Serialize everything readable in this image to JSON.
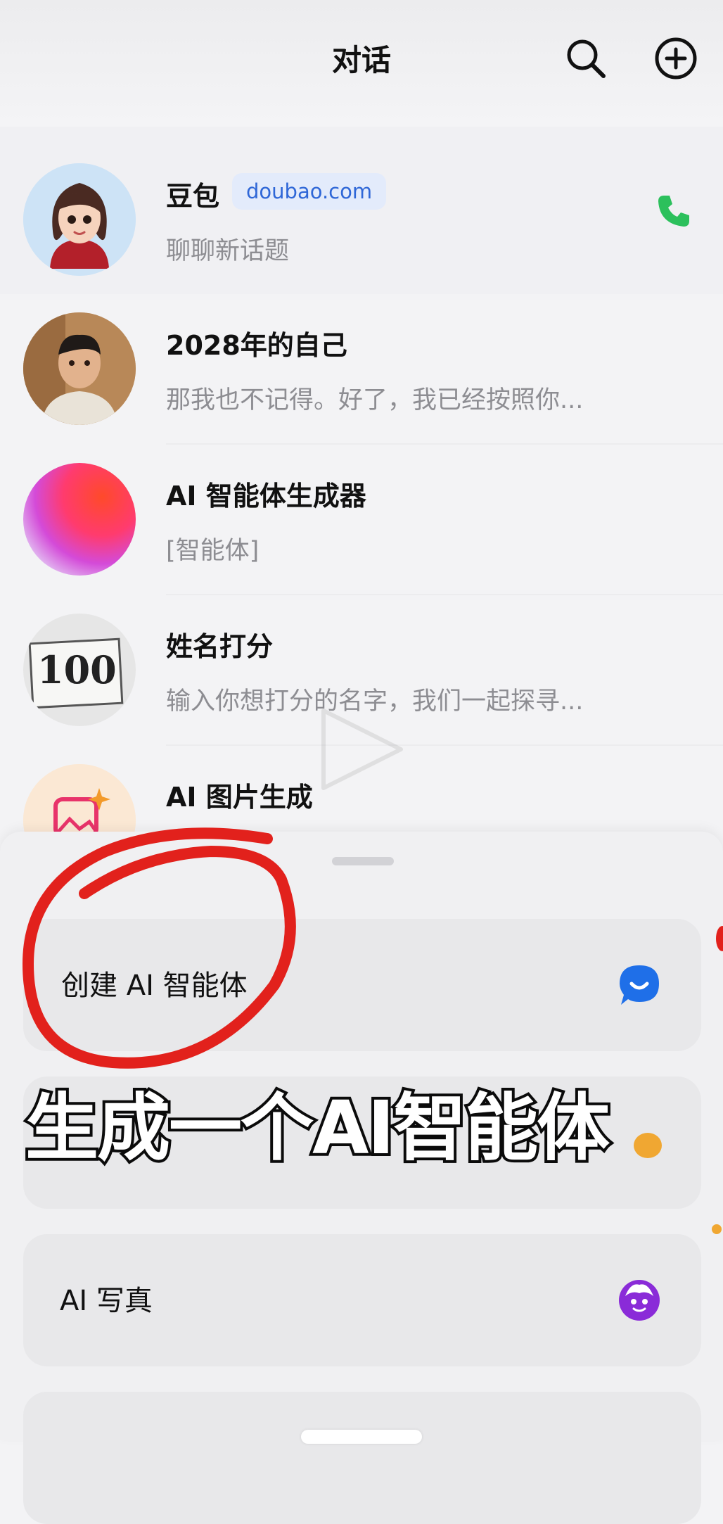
{
  "header": {
    "title": "对话",
    "search_icon": "search-icon",
    "add_icon": "plus-circle-icon"
  },
  "conversations": [
    {
      "name": "豆包",
      "badge": "doubao.com",
      "preview": "聊聊新话题",
      "action_icon": "phone-icon",
      "pinned": true
    },
    {
      "name": "2028年的自己",
      "preview": "那我也不记得。好了，我已经按照你..."
    },
    {
      "name": "AI 智能体生成器",
      "preview": "[智能体]"
    },
    {
      "name": "姓名打分",
      "preview": "输入你想打分的名字，我们一起探寻...",
      "avatar_text": "100"
    },
    {
      "name": "AI 图片生成",
      "preview": ""
    }
  ],
  "sheet": {
    "cards": [
      {
        "label": "创建 AI 智能体",
        "icon": "chat-bubble-icon"
      },
      {
        "label": "",
        "icon": "orange-icon"
      },
      {
        "label": "AI 写真",
        "icon": "face-icon"
      }
    ]
  },
  "overlay_caption": "生成一个AI智能体",
  "colors": {
    "accent_blue": "#2f67d7",
    "phone_green": "#2cc05c",
    "annotation_red": "#e2211c",
    "face_purple": "#8a2bd8"
  }
}
